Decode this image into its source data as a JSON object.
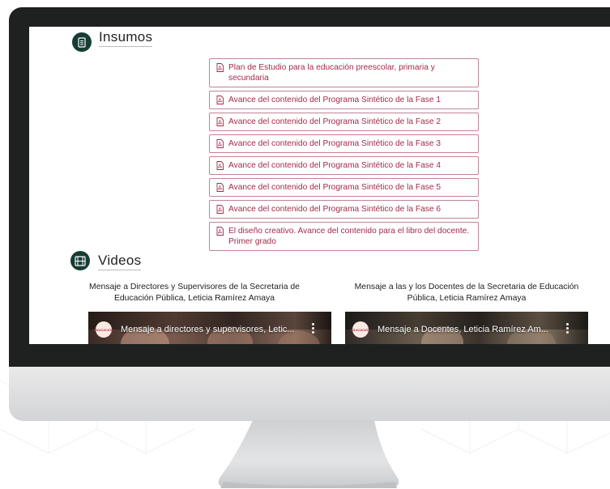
{
  "sections": {
    "insumos": {
      "title": "Insumos",
      "icon": "document-icon"
    },
    "videos": {
      "title": "Videos",
      "icon": "film-icon"
    }
  },
  "insumos_links": [
    {
      "text": "Plan de Estudio para la educación preescolar, primaria y secundaria"
    },
    {
      "text": "Avance del contenido del Programa Sintético de la Fase 1"
    },
    {
      "text": "Avance del contenido del Programa Sintético de la Fase 2"
    },
    {
      "text": "Avance del contenido del Programa Sintético de la Fase 3"
    },
    {
      "text": "Avance del contenido del Programa Sintético de la Fase 4"
    },
    {
      "text": "Avance del contenido del Programa Sintético de la Fase 5"
    },
    {
      "text": "Avance del contenido del Programa Sintético de la Fase 6"
    },
    {
      "text": "El diseño creativo. Avance del contenido para el libro del docente. Primer grado"
    }
  ],
  "videos": [
    {
      "caption": "Mensaje a Directores y Supervisores de la Secretaria de Educación Pública, Leticia Ramírez Amaya",
      "thumb_title": "Mensaje a directores y supervisores, Letic...",
      "channel_badge": "EDUCACIÓN",
      "icon": "video-menu-icon"
    },
    {
      "caption": "Mensaje a las y los Docentes de la Secretaria de Educación Pública, Leticia Ramírez Amaya",
      "thumb_title": "Mensaje a Docentes, Leticia Ramírez Am...",
      "channel_badge": "EDUCACIÓN",
      "icon": "video-menu-icon"
    }
  ],
  "colors": {
    "accent": "#a42a4a",
    "link_border": "#c08593",
    "icon_circle": "#173c34",
    "bezel": "#1f2020"
  }
}
